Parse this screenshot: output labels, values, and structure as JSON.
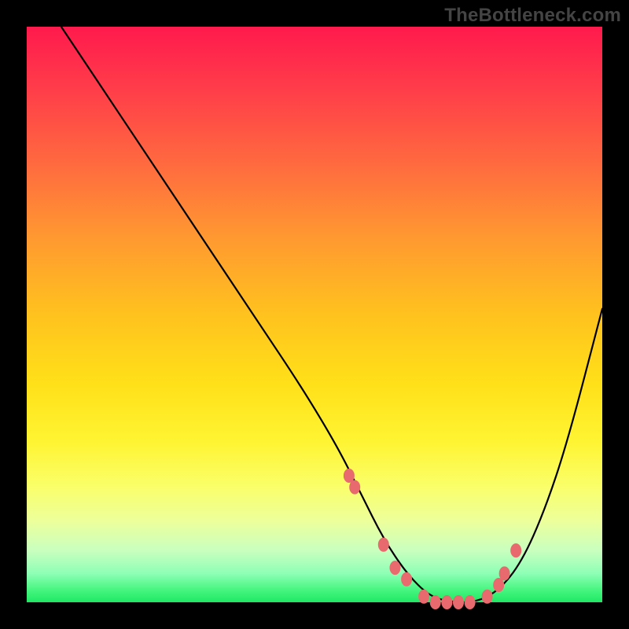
{
  "watermark": "TheBottleneck.com",
  "chart_data": {
    "type": "line",
    "title": "",
    "xlabel": "",
    "ylabel": "",
    "xlim": [
      0,
      100
    ],
    "ylim": [
      0,
      100
    ],
    "note": "No numeric axes or labels rendered; values only implied by gradient and curve height.",
    "curve": {
      "name": "bottleneck-curve",
      "x": [
        6,
        12,
        20,
        30,
        40,
        48,
        54,
        58,
        62,
        66,
        70,
        74,
        78,
        82,
        86,
        90,
        94,
        100
      ],
      "y": [
        100,
        91,
        79,
        64,
        49,
        37,
        27,
        19,
        11,
        5,
        1,
        0,
        0,
        2,
        7,
        16,
        28,
        51
      ]
    },
    "markers": {
      "name": "highlight-points",
      "color": "#e86a6f",
      "x": [
        56,
        57,
        62,
        64,
        66,
        69,
        71,
        73,
        75,
        77,
        80,
        82,
        83,
        85
      ],
      "y": [
        22,
        20,
        10,
        6,
        4,
        1,
        0,
        0,
        0,
        0,
        1,
        3,
        5,
        9
      ]
    }
  }
}
